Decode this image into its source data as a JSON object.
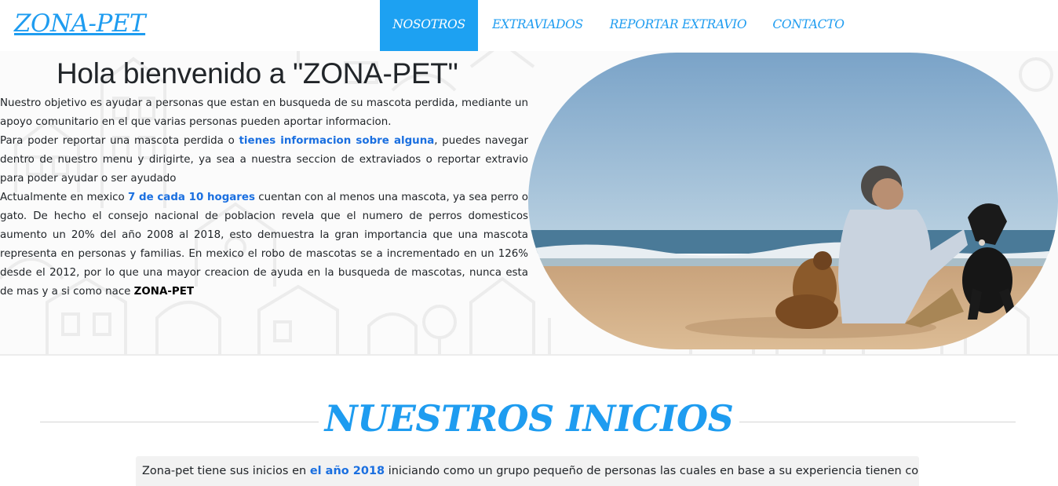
{
  "navbar": {
    "brand": "ZONA-PET",
    "items": [
      {
        "label": "NOSOTROS",
        "active": true
      },
      {
        "label": "EXTRAVIADOS",
        "active": false
      },
      {
        "label": "REPORTAR EXTRAVIO",
        "active": false
      },
      {
        "label": "CONTACTO",
        "active": false
      }
    ]
  },
  "hero": {
    "title": "Hola bienvenido a \"ZONA-PET\"",
    "p1": "Nuestro objetivo es ayudar a personas que estan en busqueda de su mascota perdida, mediante un apoyo comunitario en el que varias personas pueden aportar informacion.",
    "p2_before": "Para poder reportar una mascota perdida o ",
    "p2_highlight": "tienes informacion sobre alguna",
    "p2_after": ", puedes navegar dentro de nuestro menu y dirigirte, ya sea a nuestra seccion de extraviados o reportar extravio para poder ayudar o ser ayudado",
    "p3_before": "Actualmente en mexico ",
    "p3_highlight": "7 de cada 10 hogares",
    "p3_middle": " cuentan con al menos una mascota, ya sea perro o gato. De hecho el consejo nacional de poblacion revela que el numero de perros domesticos aumento un 20% del año 2008 al 2018, esto demuestra la gran importancia que una mascota representa en personas y familias. En mexico el robo de mascotas se a incrementado en un 126% desde el 2012, por lo que una mayor creacion de ayuda en la busqueda de mascotas, nunca esta de mas y a si como nace ",
    "p3_bold": "ZONA-PET"
  },
  "section": {
    "title": "NUESTROS INICIOS",
    "text_before": "Zona-pet tiene sus inicios en ",
    "text_highlight": "el año 2018",
    "text_after": " iniciando como un grupo pequeño de personas las cuales en base a su experiencia tienen como"
  },
  "colors": {
    "accent": "#1e9cf0",
    "active_nav_bg": "#1da1f2",
    "highlight_text": "#1a6fe0"
  }
}
